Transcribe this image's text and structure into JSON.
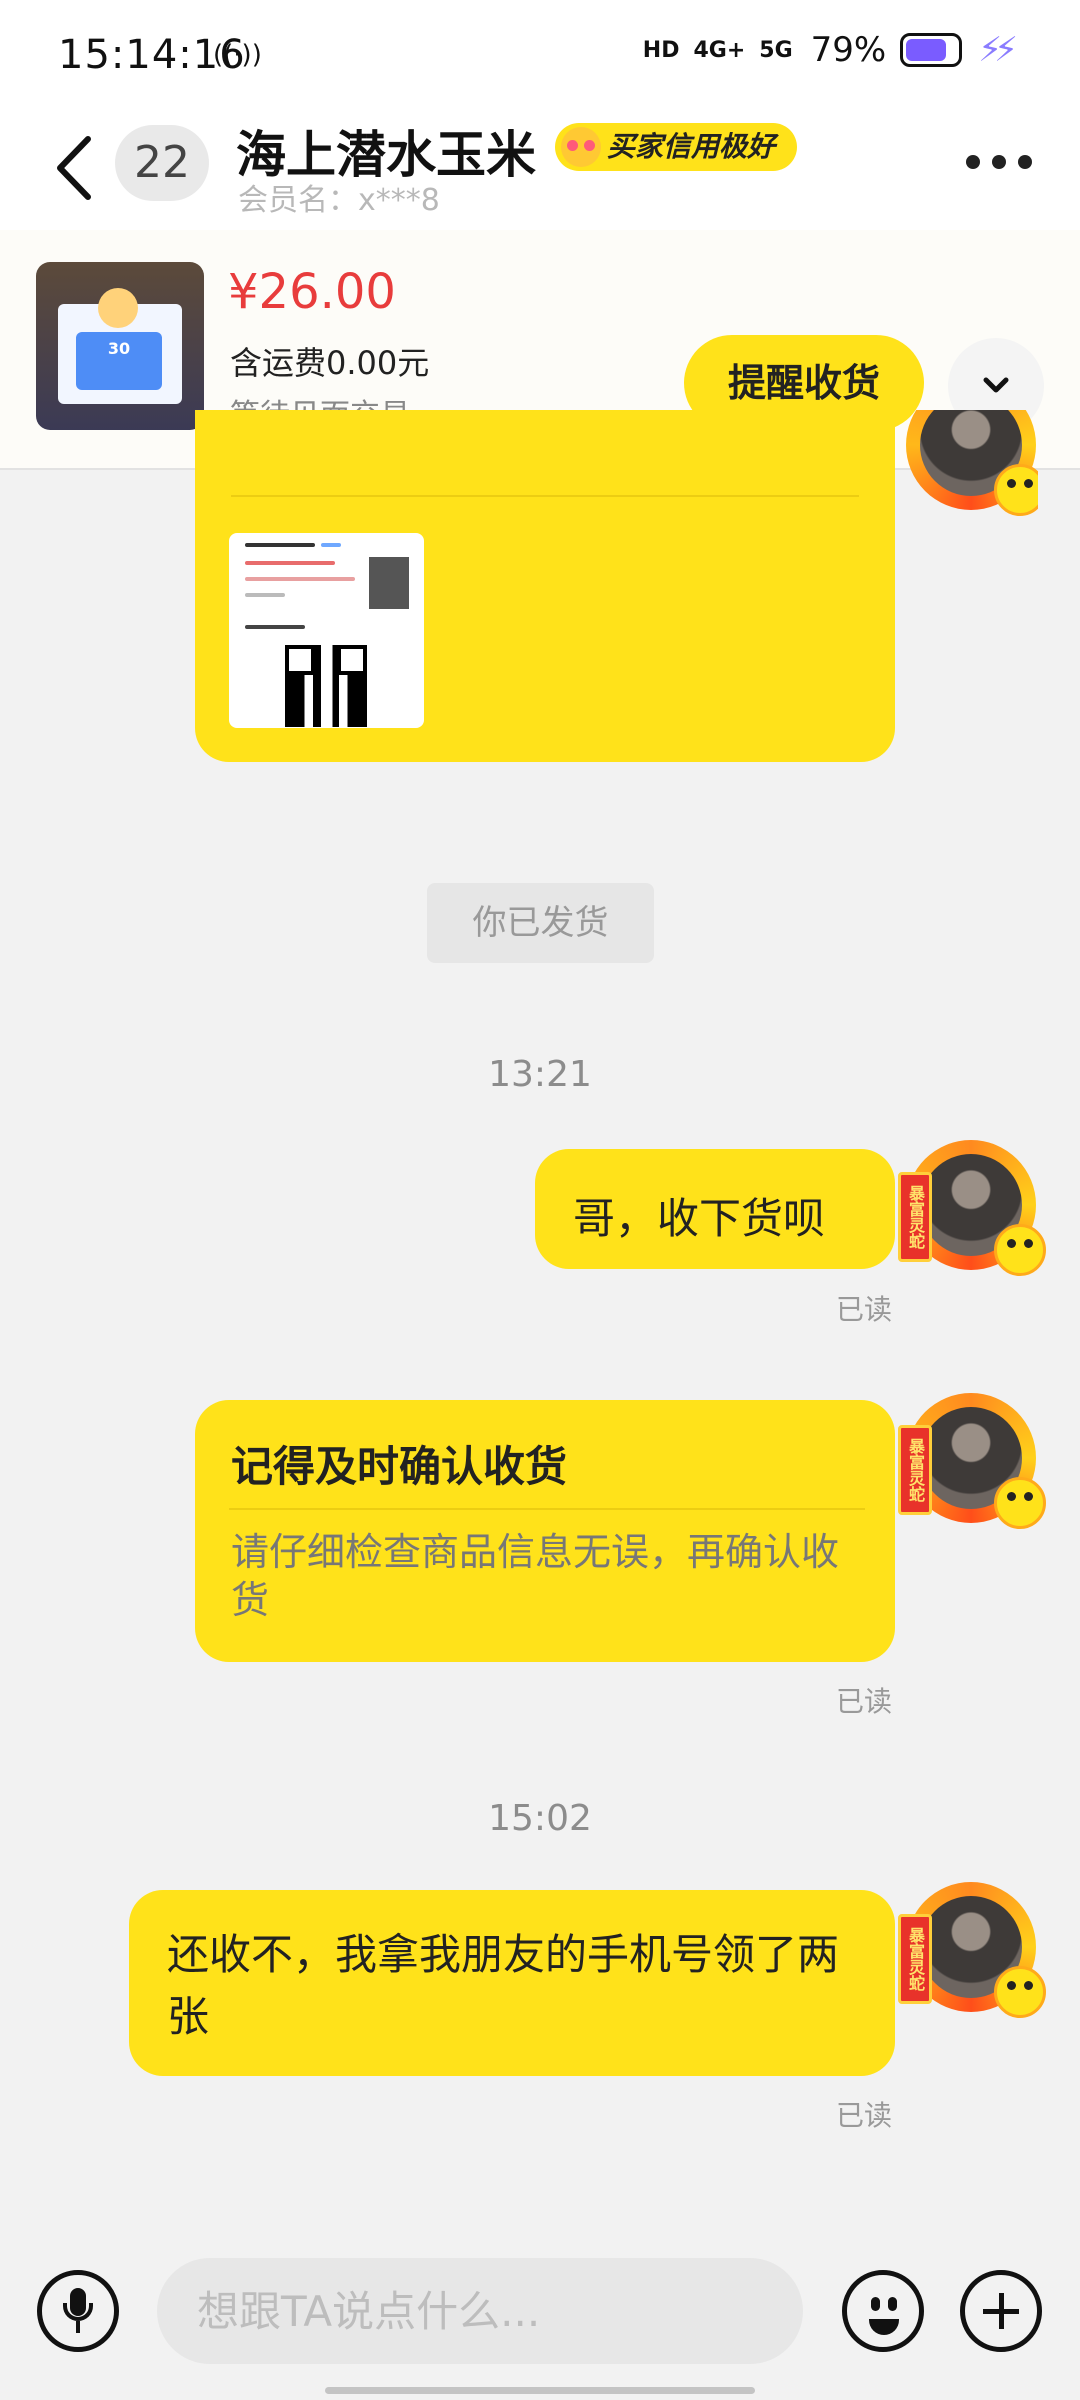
{
  "status_bar": {
    "time": "15:14:16",
    "record_icon": "((·))",
    "hd": "HD",
    "net_4g": "4G+",
    "net_5g": "5G",
    "battery_percent": "79%",
    "battery_level": 0.79,
    "accent": "#7a5cff"
  },
  "header": {
    "unread_count": "22",
    "peer_name": "海上潜水玉米",
    "credit_badge": "买家信用极好",
    "member_label": "会员名：x***8"
  },
  "order": {
    "thumb_text": "30",
    "price": "¥26.00",
    "shipping": "含运费0.00元",
    "status": "等待见面交易",
    "remind_button": "提醒收货"
  },
  "chat": {
    "system_notice": "你已发货",
    "time_1": "13:21",
    "msg_1": "哥，收下货呗",
    "read_1": "已读",
    "card_title": "记得及时确认收货",
    "card_body": "请仔细检查商品信息无误，再确认收货",
    "read_2": "已读",
    "time_2": "15:02",
    "msg_2": "还收不，我拿我朋友的手机号领了两张",
    "read_3": "已读",
    "avatar_tag": "暴富灵蛇"
  },
  "input": {
    "placeholder": "想跟TA说点什么..."
  },
  "colors": {
    "bubble": "#ffe21a",
    "price": "#e83c3c"
  }
}
